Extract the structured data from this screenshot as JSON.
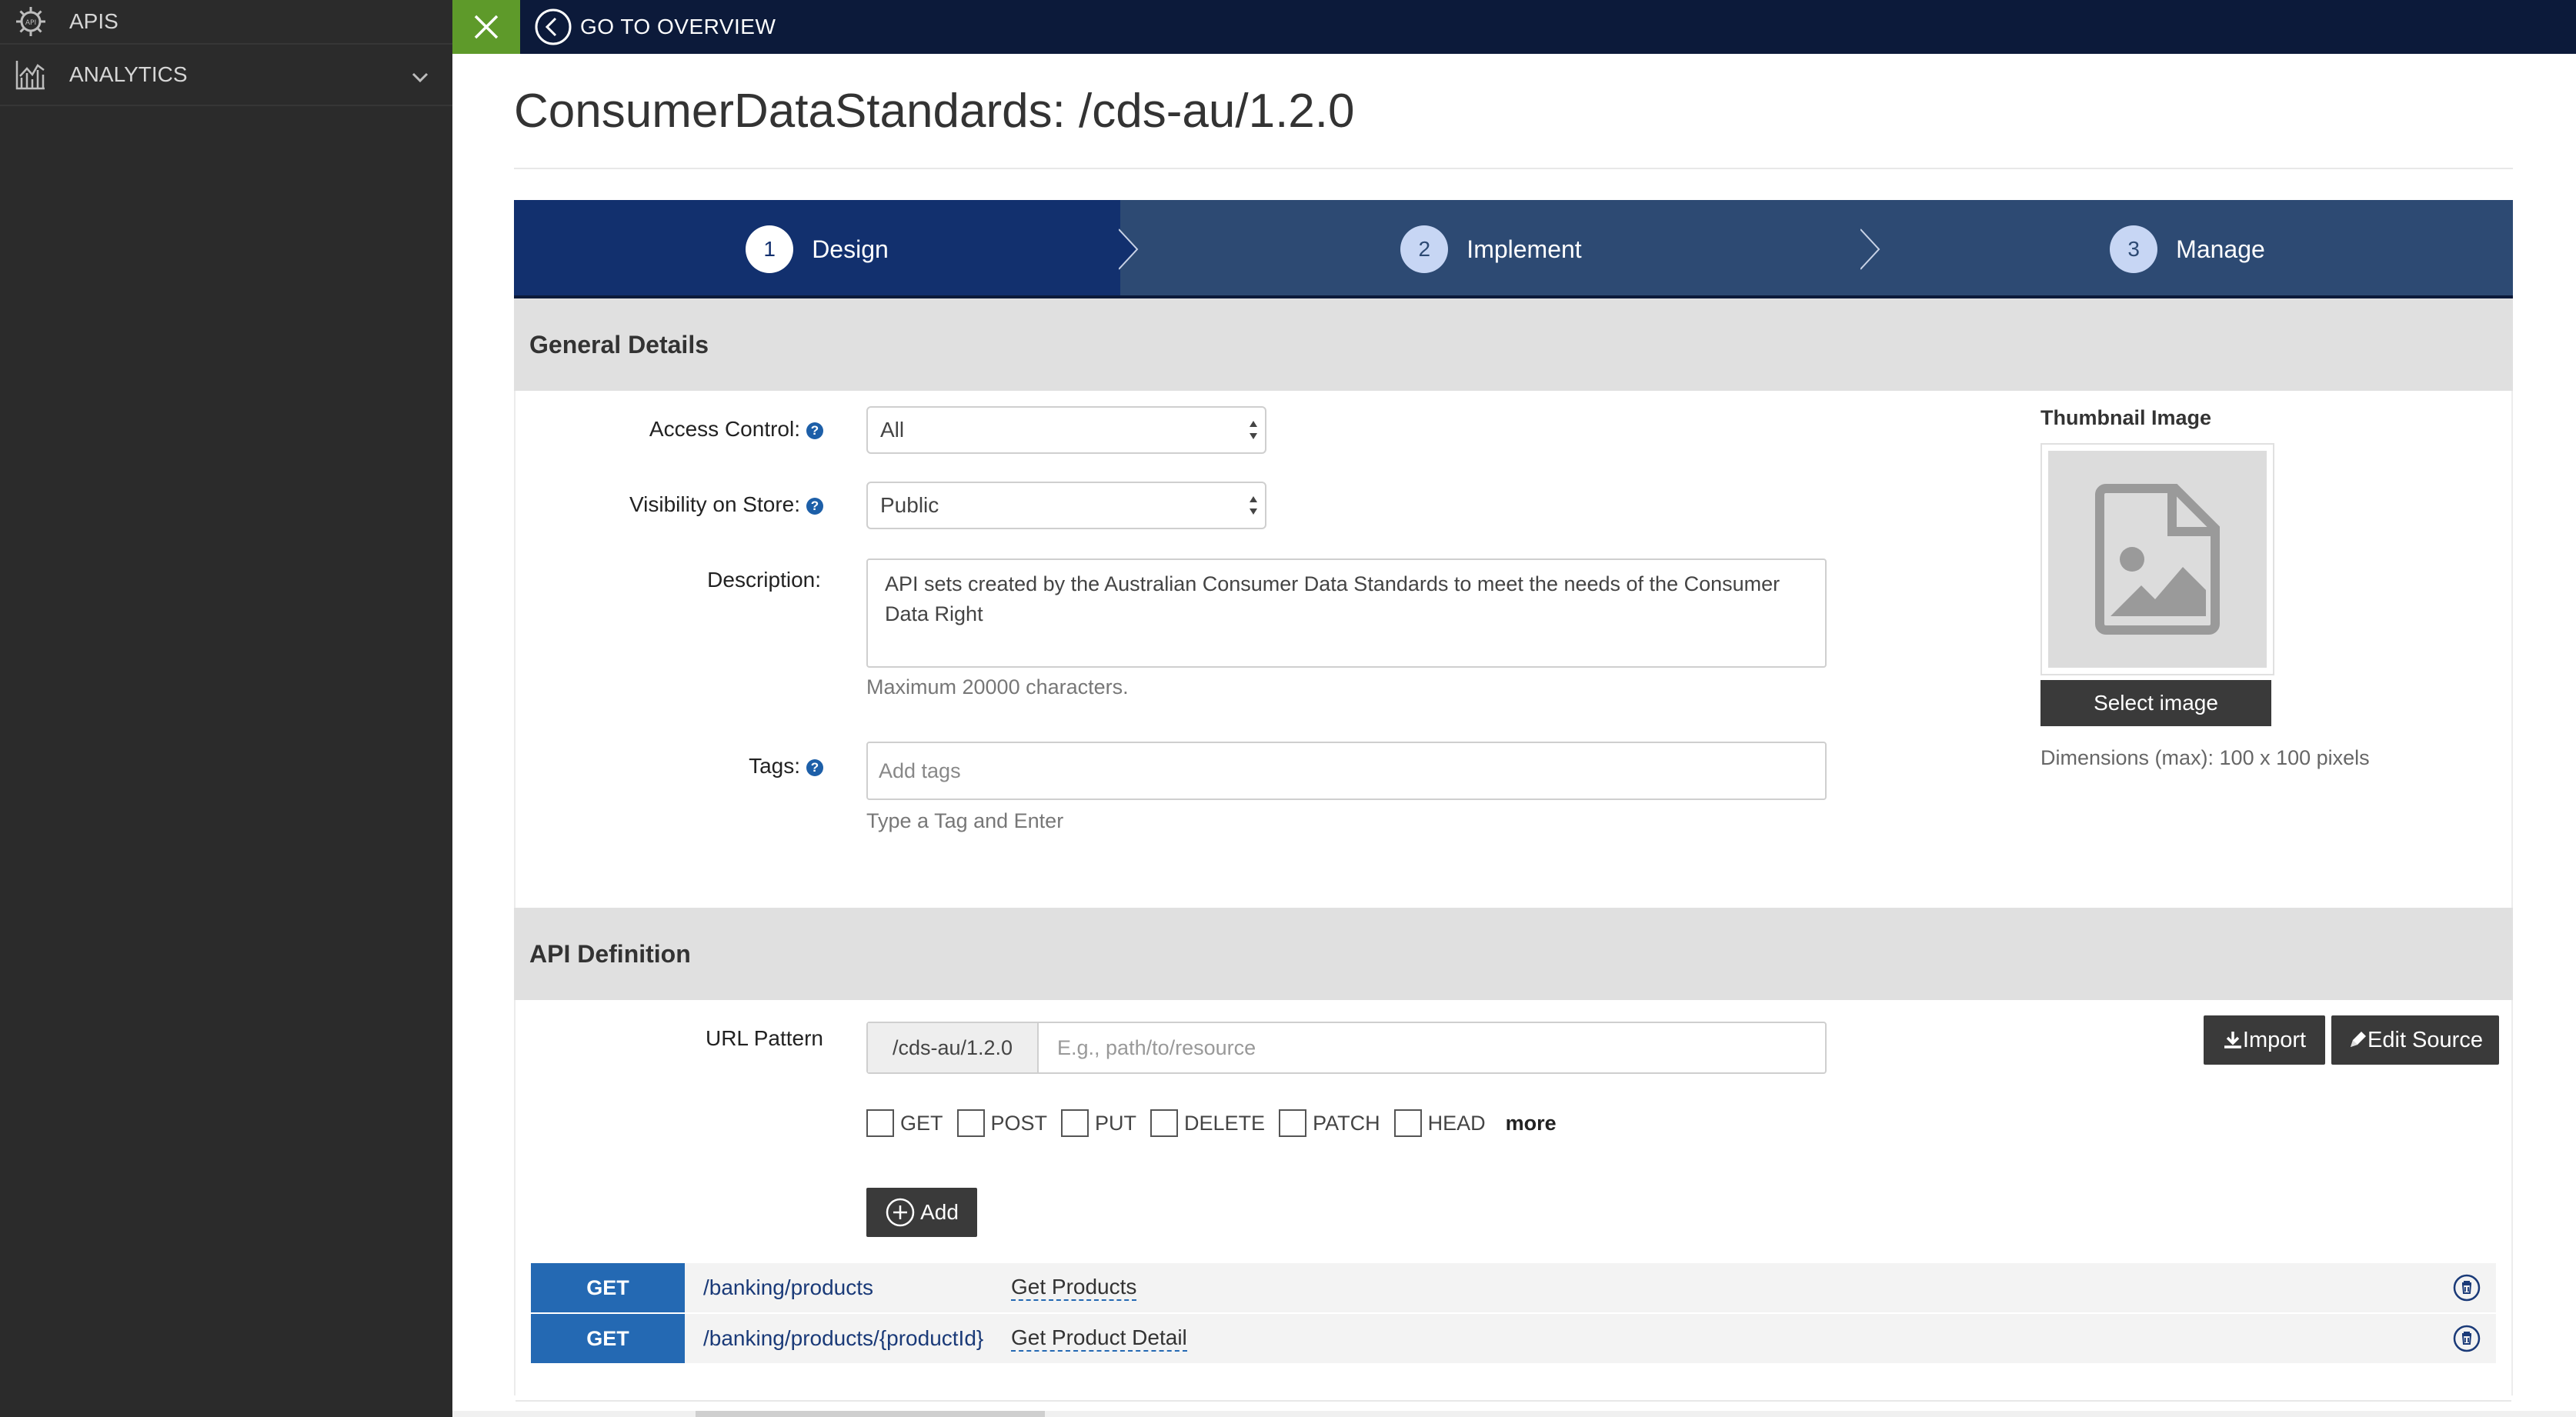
{
  "sidebar": {
    "items": [
      {
        "label": "APIS",
        "icon": "api-gear-icon"
      },
      {
        "label": "ANALYTICS",
        "icon": "analytics-chart-icon",
        "expandable": true
      }
    ]
  },
  "topbar": {
    "back_label": "GO TO OVERVIEW",
    "colors": {
      "bar": "#0c1a3a",
      "close": "#5e9a2a"
    }
  },
  "page": {
    "title": "ConsumerDataStandards: /cds-au/1.2.0"
  },
  "wizard": {
    "steps": [
      {
        "number": "1",
        "label": "Design",
        "active": true
      },
      {
        "number": "2",
        "label": "Implement",
        "active": false
      },
      {
        "number": "3",
        "label": "Manage",
        "active": false
      }
    ]
  },
  "general": {
    "heading": "General Details",
    "access_control": {
      "label": "Access Control:",
      "value": "All"
    },
    "visibility": {
      "label": "Visibility on Store:",
      "value": "Public"
    },
    "description": {
      "label": "Description:",
      "value": "API sets created by the Australian Consumer Data Standards to meet the needs of the Consumer Data Right",
      "hint": "Maximum 20000 characters."
    },
    "tags": {
      "label": "Tags:",
      "placeholder": "Add tags",
      "hint": "Type a Tag and Enter"
    },
    "thumbnail": {
      "title": "Thumbnail Image",
      "button": "Select image",
      "dimensions": "Dimensions (max): 100 x 100 pixels"
    },
    "help_glyph": "?"
  },
  "api_definition": {
    "heading": "API Definition",
    "url_label": "URL Pattern",
    "url_prefix": "/cds-au/1.2.0",
    "url_placeholder": "E.g., path/to/resource",
    "import_label": "Import",
    "edit_source_label": "Edit Source",
    "methods": [
      "GET",
      "POST",
      "PUT",
      "DELETE",
      "PATCH",
      "HEAD"
    ],
    "more_label": "more",
    "add_label": "Add",
    "resources": [
      {
        "verb": "GET",
        "path": "/banking/products",
        "summary": "Get Products"
      },
      {
        "verb": "GET",
        "path": "/banking/products/{productId}",
        "summary": "Get Product Detail"
      }
    ]
  }
}
